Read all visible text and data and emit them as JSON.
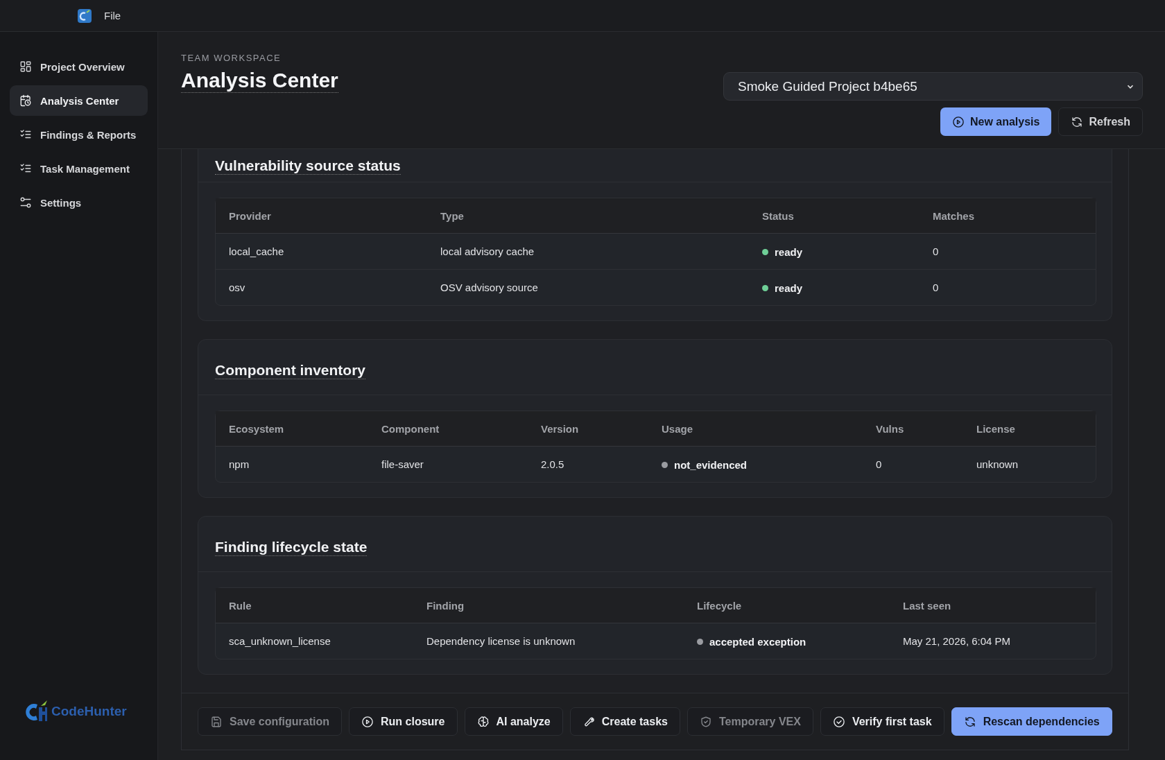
{
  "app_bar": {
    "menu": [
      "File"
    ]
  },
  "sidebar": {
    "items": [
      {
        "label": "Project Overview",
        "kind": "grid",
        "selected": false
      },
      {
        "label": "Analysis Center",
        "kind": "calendar",
        "selected": true
      },
      {
        "label": "Findings & Reports",
        "kind": "checklist",
        "selected": false
      },
      {
        "label": "Task Management",
        "kind": "checklist",
        "selected": false
      },
      {
        "label": "Settings",
        "kind": "sliders",
        "selected": false
      }
    ],
    "brand": "CodeHunter"
  },
  "header": {
    "eyebrow": "TEAM WORKSPACE",
    "title": "Analysis Center",
    "project_select": {
      "value": "Smoke Guided Project b4be65"
    },
    "buttons": [
      {
        "label": "New analysis",
        "kind": "play",
        "primary": true
      },
      {
        "label": "Refresh",
        "kind": "refresh",
        "primary": false
      }
    ]
  },
  "sections": [
    {
      "title": "Vulnerability source status",
      "table": {
        "columns": [
          "Provider",
          "Type",
          "Status",
          "Matches"
        ],
        "rows": [
          {
            "cells": [
              "local_cache",
              "local advisory cache",
              {
                "text": "ready",
                "color": "#6fcf97"
              },
              "0"
            ]
          },
          {
            "cells": [
              "osv",
              "OSV advisory source",
              {
                "text": "ready",
                "color": "#6fcf97"
              },
              "0"
            ]
          }
        ]
      }
    },
    {
      "title": "Component inventory",
      "table": {
        "columns": [
          "Ecosystem",
          "Component",
          "Version",
          "Usage",
          "Vulns",
          "License"
        ],
        "rows": [
          {
            "cells": [
              "npm",
              "file-saver",
              "2.0.5",
              {
                "text": "not_evidenced",
                "color": "#9a9ca1"
              },
              "0",
              "unknown"
            ]
          }
        ]
      }
    },
    {
      "title": "Finding lifecycle state",
      "table": {
        "columns": [
          "Rule",
          "Finding",
          "Lifecycle",
          "Last seen"
        ],
        "rows": [
          {
            "cells": [
              "sca_unknown_license",
              "Dependency license is unknown",
              {
                "text": "accepted exception",
                "color": "#9a9ca1"
              },
              "May 21, 2026, 6:04 PM"
            ]
          }
        ]
      }
    }
  ],
  "actions": [
    {
      "label": "Save configuration",
      "kind": "save",
      "primary": false,
      "disabled": true
    },
    {
      "label": "Run closure",
      "kind": "play",
      "primary": false,
      "disabled": false
    },
    {
      "label": "AI analyze",
      "kind": "brain",
      "primary": false,
      "disabled": false
    },
    {
      "label": "Create tasks",
      "kind": "wrench",
      "primary": false,
      "disabled": false
    },
    {
      "label": "Temporary VEX",
      "kind": "shield",
      "primary": false,
      "disabled": true
    },
    {
      "label": "Verify first task",
      "kind": "check",
      "primary": false,
      "disabled": false
    },
    {
      "label": "Rescan dependencies",
      "kind": "refresh",
      "primary": true,
      "disabled": false
    }
  ]
}
